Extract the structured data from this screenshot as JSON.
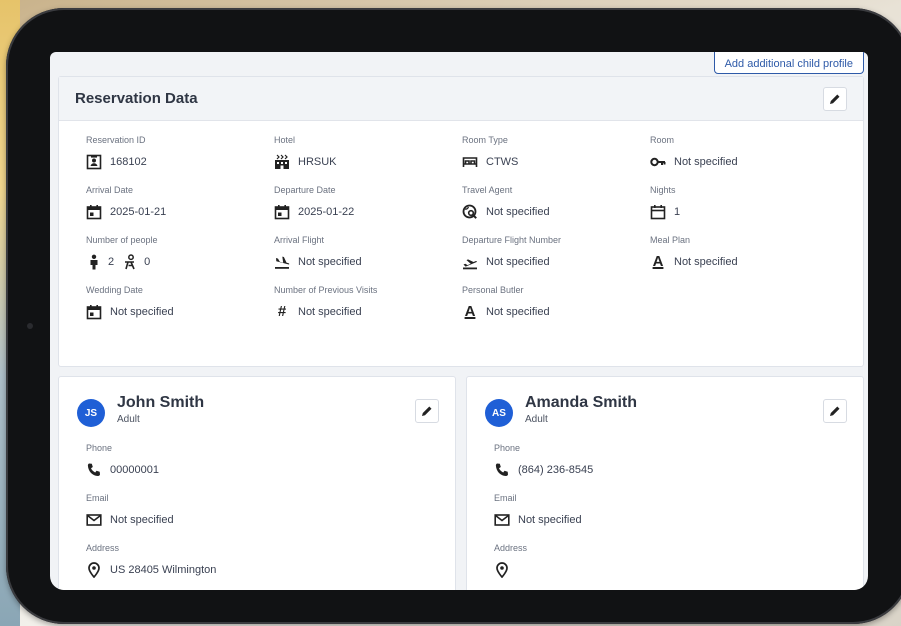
{
  "header": {
    "add_child_label": "Add additional child profile"
  },
  "reservation": {
    "title": "Reservation Data",
    "fields": {
      "reservation_id": {
        "label": "Reservation ID",
        "value": "168102"
      },
      "hotel": {
        "label": "Hotel",
        "value": "HRSUK"
      },
      "room_type": {
        "label": "Room Type",
        "value": "CTWS"
      },
      "room": {
        "label": "Room",
        "value": "Not specified"
      },
      "arrival_date": {
        "label": "Arrival Date",
        "value": "2025-01-21"
      },
      "departure_date": {
        "label": "Departure Date",
        "value": "2025-01-22"
      },
      "travel_agent": {
        "label": "Travel Agent",
        "value": "Not specified"
      },
      "nights": {
        "label": "Nights",
        "value": "1"
      },
      "number_of_people": {
        "label": "Number of people",
        "adults": "2",
        "children": "0"
      },
      "arrival_flight": {
        "label": "Arrival Flight",
        "value": "Not specified"
      },
      "departure_flight": {
        "label": "Departure Flight Number",
        "value": "Not specified"
      },
      "meal_plan": {
        "label": "Meal Plan",
        "value": "Not specified"
      },
      "wedding_date": {
        "label": "Wedding Date",
        "value": "Not specified"
      },
      "previous_visits": {
        "label": "Number of Previous Visits",
        "value": "Not specified"
      },
      "personal_butler": {
        "label": "Personal Butler",
        "value": "Not specified"
      }
    }
  },
  "guests": [
    {
      "initials": "JS",
      "name": "John Smith",
      "type": "Adult",
      "phone_label": "Phone",
      "phone": "00000001",
      "email_label": "Email",
      "email": "Not specified",
      "address_label": "Address",
      "address": "US 28405 Wilmington"
    },
    {
      "initials": "AS",
      "name": "Amanda Smith",
      "type": "Adult",
      "phone_label": "Phone",
      "phone": "(864) 236-8545",
      "email_label": "Email",
      "email": "Not specified",
      "address_label": "Address",
      "address": ""
    }
  ],
  "colors": {
    "accent": "#1f5fd6",
    "link": "#2e5aa8",
    "panel": "#f2f4f7"
  },
  "glyphs": {
    "hash": "#",
    "letter_a": "A"
  }
}
